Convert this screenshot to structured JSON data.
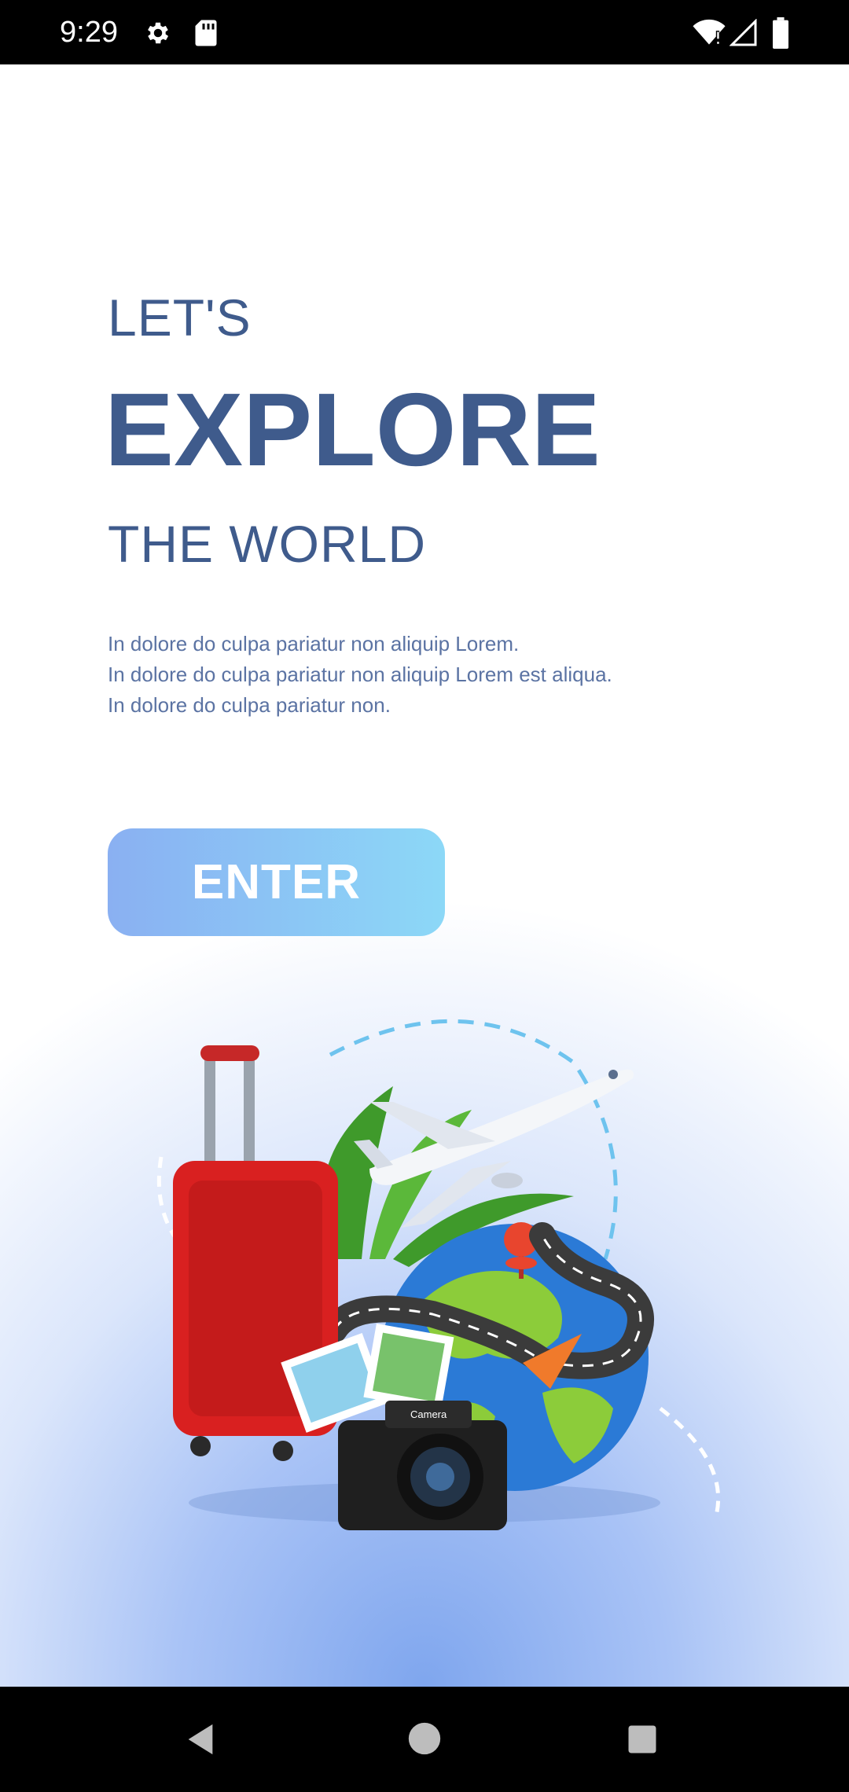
{
  "status_bar": {
    "time": "9:29",
    "icons": [
      "gear-icon",
      "sd-card-icon",
      "wifi-icon",
      "signal-icon",
      "battery-icon"
    ]
  },
  "hero": {
    "line1": "LET'S",
    "line2": "EXPLORE",
    "line3": "THE WORLD"
  },
  "description": {
    "lines": [
      "In dolore do culpa pariatur non aliquip Lorem.",
      "In dolore do culpa pariatur non aliquip Lorem est aliqua.",
      "In dolore do culpa pariatur non."
    ]
  },
  "enter_button": {
    "label": "ENTER"
  },
  "illustration": {
    "camera_label": "Camera"
  },
  "nav_bar": {
    "icons": [
      "back-icon",
      "home-icon",
      "recents-icon"
    ]
  },
  "colors": {
    "heading": "#3f5b8c",
    "body_text": "#5b73a3",
    "button_start": "#8ab0f2",
    "button_end": "#8cd8f7",
    "background_glow": "#7fa6ee"
  }
}
